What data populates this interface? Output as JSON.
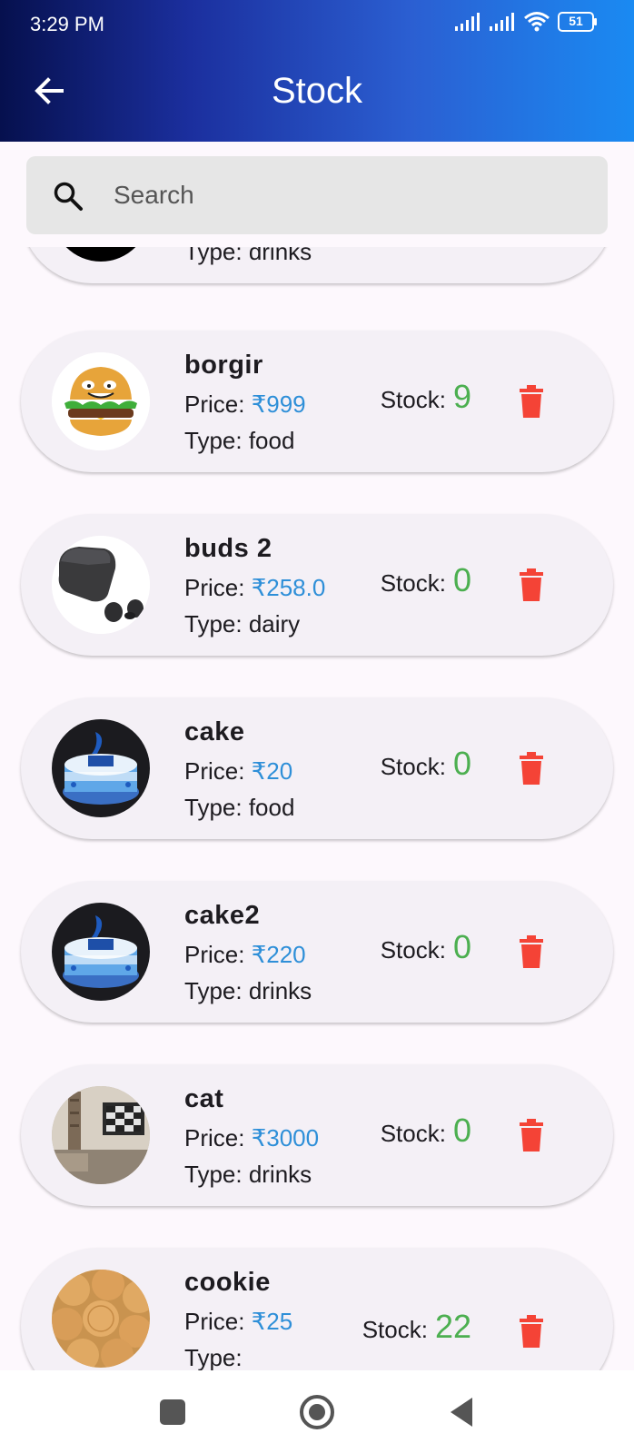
{
  "status_bar": {
    "time": "3:29 PM",
    "battery": "51",
    "icons": [
      "signal-icon",
      "signal-icon",
      "wifi-icon",
      "battery-icon"
    ]
  },
  "header": {
    "title": "Stock",
    "back_icon": "arrow-back-icon"
  },
  "search": {
    "placeholder": "Search",
    "icon": "search-icon"
  },
  "items": [
    {
      "name": "",
      "price_label": "",
      "price": "",
      "type_label": "Type: drinks",
      "stock_label": "",
      "stock": "",
      "image": "dark-circle"
    },
    {
      "name": "borgir",
      "price_label": "Price: ",
      "price": "₹999",
      "type_label": "Type: food",
      "stock_label": "Stock:",
      "stock": "9",
      "image": "burger"
    },
    {
      "name": "buds 2",
      "price_label": "Price: ",
      "price": "₹258.0",
      "type_label": "Type: dairy",
      "stock_label": "Stock:",
      "stock": "0",
      "image": "earbuds"
    },
    {
      "name": "cake",
      "price_label": "Price: ",
      "price": "₹20",
      "type_label": "Type: food",
      "stock_label": "Stock:",
      "stock": "0",
      "image": "cake"
    },
    {
      "name": "cake2",
      "price_label": "Price: ",
      "price": "₹220",
      "type_label": "Type: drinks",
      "stock_label": "Stock:",
      "stock": "0",
      "image": "cake"
    },
    {
      "name": "cat",
      "price_label": "Price: ",
      "price": "₹3000",
      "type_label": "Type: drinks",
      "stock_label": "Stock:",
      "stock": "0",
      "image": "room"
    },
    {
      "name": "cookie",
      "price_label": "Price: ",
      "price": "₹25",
      "type_label": "Type:",
      "stock_label": "Stock:",
      "stock": "22",
      "image": "cookies"
    }
  ],
  "delete_icon": "trash-icon",
  "colors": {
    "appbar_start": "#06104e",
    "appbar_end": "#1a8af2",
    "price": "#2e8fd8",
    "stock": "#4caf50",
    "delete": "#f44336",
    "card": "#f4f0f6"
  },
  "navbar": {
    "buttons": [
      "square-icon",
      "circle-home-icon",
      "triangle-back-icon"
    ]
  }
}
